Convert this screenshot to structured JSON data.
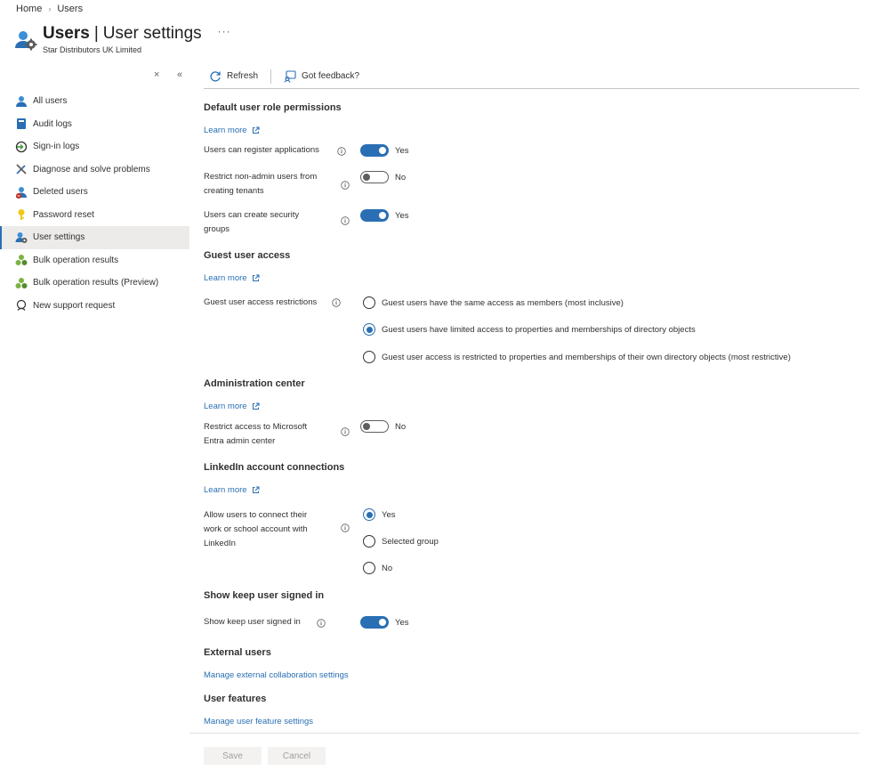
{
  "breadcrumb": {
    "items": [
      "Home",
      "Users"
    ]
  },
  "header": {
    "title_strong": "Users",
    "title_rest": "User settings",
    "subtitle": "Star Distributors UK Limited",
    "more": "···"
  },
  "sidebar_controls": {
    "close": "×",
    "collapse": "«"
  },
  "sidebar": {
    "items": [
      {
        "label": "All users",
        "icon": "user-icon"
      },
      {
        "label": "Audit logs",
        "icon": "book-icon"
      },
      {
        "label": "Sign-in logs",
        "icon": "sign-in-icon"
      },
      {
        "label": "Diagnose and solve problems",
        "icon": "tools-icon"
      },
      {
        "label": "Deleted users",
        "icon": "deleted-user-icon"
      },
      {
        "label": "Password reset",
        "icon": "key-icon"
      },
      {
        "label": "User settings",
        "icon": "user-settings-icon"
      },
      {
        "label": "Bulk operation results",
        "icon": "bulk-icon"
      },
      {
        "label": "Bulk operation results (Preview)",
        "icon": "bulk-icon"
      },
      {
        "label": "New support request",
        "icon": "support-icon"
      }
    ],
    "active_index": 6
  },
  "toolbar": {
    "refresh": "Refresh",
    "feedback": "Got feedback?"
  },
  "learn_more": "Learn more",
  "sections": {
    "default_role": {
      "title": "Default user role permissions",
      "register_apps": {
        "label": "Users can register applications",
        "state": "Yes"
      },
      "restrict_tenants": {
        "label_1": "Restrict non-admin users from",
        "label_2": "creating tenants",
        "state": "No"
      },
      "security_groups": {
        "label_1": "Users can create security",
        "label_2": "groups",
        "state": "Yes"
      }
    },
    "guest": {
      "title": "Guest user access",
      "label": "Guest user access restrictions",
      "options": [
        "Guest users have the same access as members (most inclusive)",
        "Guest users have limited access to properties and memberships of directory objects",
        "Guest user access is restricted to properties and memberships of their own directory objects (most restrictive)"
      ],
      "selected": 1
    },
    "admin_center": {
      "title": "Administration center",
      "label_1": "Restrict access to Microsoft",
      "label_2": "Entra admin center",
      "state": "No"
    },
    "linkedin": {
      "title": "LinkedIn account connections",
      "label_1": "Allow users to connect their",
      "label_2": "work or school account with",
      "label_3": "LinkedIn",
      "options": [
        "Yes",
        "Selected group",
        "No"
      ],
      "selected": 0
    },
    "kmsi": {
      "title": "Show keep user signed in",
      "label": "Show keep user signed in",
      "state": "Yes"
    },
    "external": {
      "title": "External users",
      "link": "Manage external collaboration settings"
    },
    "features": {
      "title": "User features",
      "link": "Manage user feature settings"
    }
  },
  "buttons": {
    "save": "Save",
    "cancel": "Cancel"
  },
  "colors": {
    "accent": "#2a6fb4",
    "link": "#2a6fb4",
    "text": "#323130"
  }
}
